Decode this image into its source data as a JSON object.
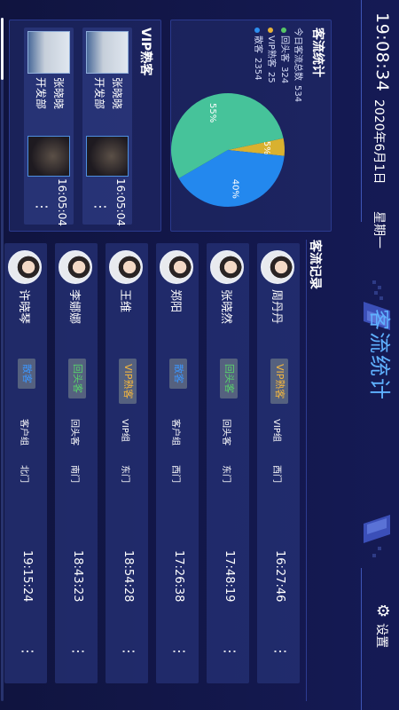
{
  "header": {
    "clock": "19:08:34",
    "date": "2020年6月1日",
    "weekday": "星期一",
    "title": "客流统计",
    "settings_label": "设置"
  },
  "stats": {
    "title": "客流统计",
    "items": [
      {
        "label": "今日客流总数",
        "value": "534",
        "color": ""
      },
      {
        "label": "回头客",
        "value": "324",
        "color": "#57c766"
      },
      {
        "label": "VIP熟客",
        "value": "25",
        "color": "#e6b23a"
      },
      {
        "label": "散客",
        "value": "2354",
        "color": "#2c8ff0"
      }
    ]
  },
  "chart_data": {
    "type": "pie",
    "labels": [
      "5%",
      "40%",
      "55%"
    ],
    "values": [
      5,
      40,
      55
    ],
    "colors": [
      "#d9b12f",
      "#2388ee",
      "#46c39a"
    ]
  },
  "vip": {
    "title": "VIP熟客",
    "items": [
      {
        "name": "张晓晓",
        "dept": "开发部",
        "time": "16:05:04",
        "more": "⋮"
      },
      {
        "name": "张晓晓",
        "dept": "开发部",
        "time": "16:05:04",
        "more": "⋮"
      }
    ]
  },
  "records": {
    "title": "客流记录",
    "items": [
      {
        "name": "周丹丹",
        "tag": "VIP熟客",
        "tag_color": "#f5b73e",
        "group": "VIP组",
        "door": "西门",
        "time": "16:27:46",
        "more": "⋮"
      },
      {
        "name": "张晓然",
        "tag": "回头客",
        "tag_color": "#58d46b",
        "group": "回头客",
        "door": "东门",
        "time": "17:48:19",
        "more": "⋮"
      },
      {
        "name": "郑阳",
        "tag": "散客",
        "tag_color": "#3c96ff",
        "group": "客户组",
        "door": "西门",
        "time": "17:26:38",
        "more": "⋮"
      },
      {
        "name": "王维",
        "tag": "VIP熟客",
        "tag_color": "#f5b73e",
        "group": "VIP组",
        "door": "东门",
        "time": "18:54:28",
        "more": "⋮"
      },
      {
        "name": "李娜娜",
        "tag": "回头客",
        "tag_color": "#58d46b",
        "group": "回头客",
        "door": "南门",
        "time": "18:43:23",
        "more": "⋮"
      },
      {
        "name": "许晓琴",
        "tag": "散客",
        "tag_color": "#3c96ff",
        "group": "客户组",
        "door": "北门",
        "time": "19:15:24",
        "more": "⋮"
      }
    ]
  },
  "icons": {
    "settings": "gear-icon",
    "more": "more-vertical-icon"
  }
}
